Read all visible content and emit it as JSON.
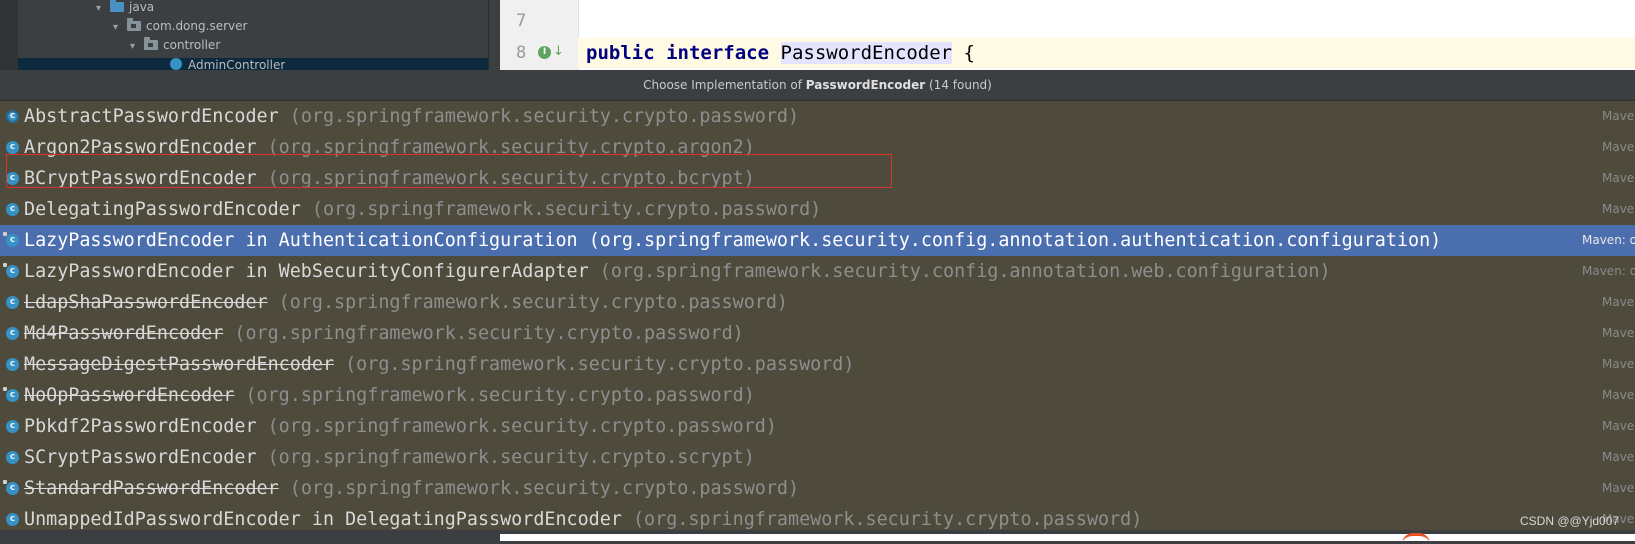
{
  "project_tree": {
    "rows": [
      {
        "label": "java"
      },
      {
        "label": "com.dong.server"
      },
      {
        "label": "controller"
      },
      {
        "label": "AdminController"
      }
    ]
  },
  "editor": {
    "line7": "7",
    "line8": "8",
    "impl_marker": "I",
    "code_kw1": "public",
    "code_kw2": "interface",
    "code_ident": "PasswordEncoder",
    "code_brace": "{"
  },
  "popup": {
    "header_prefix": "Choose Implementation of ",
    "header_target": "PasswordEncoder",
    "header_suffix": " (14 found)",
    "items": [
      {
        "name": "AbstractPasswordEncoder",
        "in": "",
        "package": "(org.springframework.security.crypto.password)",
        "location": "Maven",
        "deprecated": false,
        "selected": false,
        "icon": "abstract-class-icon"
      },
      {
        "name": "Argon2PasswordEncoder",
        "in": "",
        "package": "(org.springframework.security.crypto.argon2)",
        "location": "Maven",
        "deprecated": false,
        "selected": false,
        "icon": "class-icon"
      },
      {
        "name": "BCryptPasswordEncoder",
        "in": "",
        "package": "(org.springframework.security.crypto.bcrypt)",
        "location": "Maven",
        "deprecated": false,
        "selected": false,
        "icon": "class-icon"
      },
      {
        "name": "DelegatingPasswordEncoder",
        "in": "",
        "package": "(org.springframework.security.crypto.password)",
        "location": "Maven",
        "deprecated": false,
        "selected": false,
        "icon": "class-icon"
      },
      {
        "name": "LazyPasswordEncoder in AuthenticationConfiguration",
        "in": "",
        "package": "(org.springframework.security.config.annotation.authentication.configuration)",
        "location": "Maven: o",
        "deprecated": false,
        "selected": true,
        "icon": "private-class-icon"
      },
      {
        "name": "LazyPasswordEncoder in WebSecurityConfigurerAdapter",
        "in": "",
        "package": "(org.springframework.security.config.annotation.web.configuration)",
        "location": "Maven: o",
        "deprecated": false,
        "selected": false,
        "icon": "private-class-icon"
      },
      {
        "name": "LdapShaPasswordEncoder",
        "in": "",
        "package": "(org.springframework.security.crypto.password)",
        "location": "Maven",
        "deprecated": true,
        "selected": false,
        "icon": "class-icon"
      },
      {
        "name": "Md4PasswordEncoder",
        "in": "",
        "package": "(org.springframework.security.crypto.password)",
        "location": "Maven",
        "deprecated": true,
        "selected": false,
        "icon": "class-icon"
      },
      {
        "name": "MessageDigestPasswordEncoder",
        "in": "",
        "package": "(org.springframework.security.crypto.password)",
        "location": "Maven",
        "deprecated": true,
        "selected": false,
        "icon": "class-icon"
      },
      {
        "name": "NoOpPasswordEncoder",
        "in": "",
        "package": "(org.springframework.security.crypto.password)",
        "location": "Maven",
        "deprecated": true,
        "selected": false,
        "icon": "private-class-icon"
      },
      {
        "name": "Pbkdf2PasswordEncoder",
        "in": "",
        "package": "(org.springframework.security.crypto.password)",
        "location": "Maven",
        "deprecated": false,
        "selected": false,
        "icon": "class-icon"
      },
      {
        "name": "SCryptPasswordEncoder",
        "in": "",
        "package": "(org.springframework.security.crypto.scrypt)",
        "location": "Maven",
        "deprecated": false,
        "selected": false,
        "icon": "class-icon"
      },
      {
        "name": "StandardPasswordEncoder",
        "in": "",
        "package": "(org.springframework.security.crypto.password)",
        "location": "Maven",
        "deprecated": true,
        "selected": false,
        "icon": "private-class-icon"
      },
      {
        "name": "UnmappedIdPasswordEncoder in DelegatingPasswordEncoder",
        "in": "",
        "package": "(org.springframework.security.crypto.password)",
        "location": "Maven",
        "deprecated": false,
        "selected": false,
        "icon": "class-icon"
      }
    ]
  },
  "watermark": "CSDN @@Yjd007",
  "colors": {
    "selection": "#4b6eaf",
    "popup_bg": "#4e4a3c",
    "highlight_border": "#d9312b",
    "keyword": "#000080"
  }
}
